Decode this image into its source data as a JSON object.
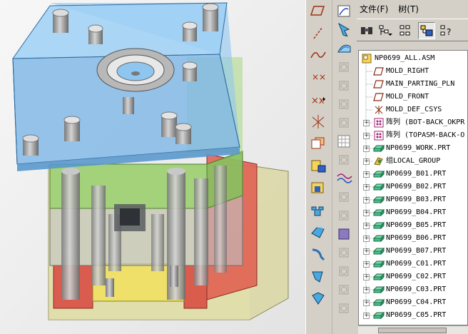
{
  "menu": {
    "file": "文件(F)",
    "tree": "树(T)"
  },
  "tree_toolbar": [
    {
      "icon": "show-icon"
    },
    {
      "icon": "settings-tree-icon"
    },
    {
      "icon": "columns-icon"
    },
    {
      "icon": "tree-filter-icon"
    },
    {
      "icon": "more-icon"
    }
  ],
  "model_tree": {
    "root": "NP0699_ALL.ASM",
    "items": [
      {
        "label": "MOLD_RIGHT",
        "icon": "datum-plane-icon",
        "expandable": false
      },
      {
        "label": "MAIN_PARTING_PLN",
        "icon": "datum-plane-icon",
        "expandable": false
      },
      {
        "label": "MOLD_FRONT",
        "icon": "datum-plane-icon",
        "expandable": false
      },
      {
        "label": "MOLD_DEF_CSYS",
        "icon": "csys-icon",
        "expandable": false
      },
      {
        "label": "阵列 (BOT-BACK_OKPR",
        "icon": "pattern-icon",
        "expandable": true
      },
      {
        "label": "阵列 (TOPASM-BACK-O",
        "icon": "pattern-icon",
        "expandable": true
      },
      {
        "label": "NP0699_WORK.PRT",
        "icon": "part-icon",
        "expandable": true
      },
      {
        "label": "组LOCAL_GROUP",
        "icon": "group-icon",
        "expandable": true
      },
      {
        "label": "NP0699_B01.PRT",
        "icon": "part-icon",
        "expandable": true
      },
      {
        "label": "NP0699_B02.PRT",
        "icon": "part-icon",
        "expandable": true
      },
      {
        "label": "NP0699_B03.PRT",
        "icon": "part-icon",
        "expandable": true
      },
      {
        "label": "NP0699_B04.PRT",
        "icon": "part-icon",
        "expandable": true
      },
      {
        "label": "NP0699_B05.PRT",
        "icon": "part-icon",
        "expandable": true
      },
      {
        "label": "NP0699_B06.PRT",
        "icon": "part-icon",
        "expandable": true
      },
      {
        "label": "NP0699_B07.PRT",
        "icon": "part-icon",
        "expandable": true
      },
      {
        "label": "NP0699_C01.PRT",
        "icon": "part-icon",
        "expandable": true
      },
      {
        "label": "NP0699_C02.PRT",
        "icon": "part-icon",
        "expandable": true
      },
      {
        "label": "NP0699_C03.PRT",
        "icon": "part-icon",
        "expandable": true
      },
      {
        "label": "NP0699_C04.PRT",
        "icon": "part-icon",
        "expandable": true
      },
      {
        "label": "NP0699_C05.PRT",
        "icon": "part-icon",
        "expandable": true
      }
    ]
  },
  "toolbar_left": [
    "datum-plane-tool-icon",
    "datum-axis-tool-icon",
    "datum-curve-tool-icon",
    "datum-point-tool-icon",
    "point-offset-tool-icon",
    "csys-tool-icon",
    "analysis-tool-icon",
    "component-create-icon",
    "mold-volume-icon",
    "volume-split-icon",
    "parting-surface-icon",
    "extract-icon",
    "flow-icon",
    "cooling-icon"
  ],
  "toolbar_right": [
    "sketch-tool-icon",
    "orient-icon",
    "sketch-surface-icon",
    "disabled-icon",
    "disabled-icon",
    "disabled-icon",
    "disabled-icon",
    "grid-tool-icon",
    "disabled-icon",
    "wave-icon",
    "disabled-icon",
    "disabled-icon",
    "shade-icon",
    "disabled-icon",
    "disabled-icon",
    "disabled-icon",
    "disabled-icon"
  ],
  "colors": {
    "top_plate": "#7fb7e6",
    "green_plate": "#9ad36a",
    "red_plate": "#d9534f",
    "base_plate": "#d8d69a",
    "yellow_block": "#f0e060",
    "viewport_bg": "#f0f0f0"
  }
}
